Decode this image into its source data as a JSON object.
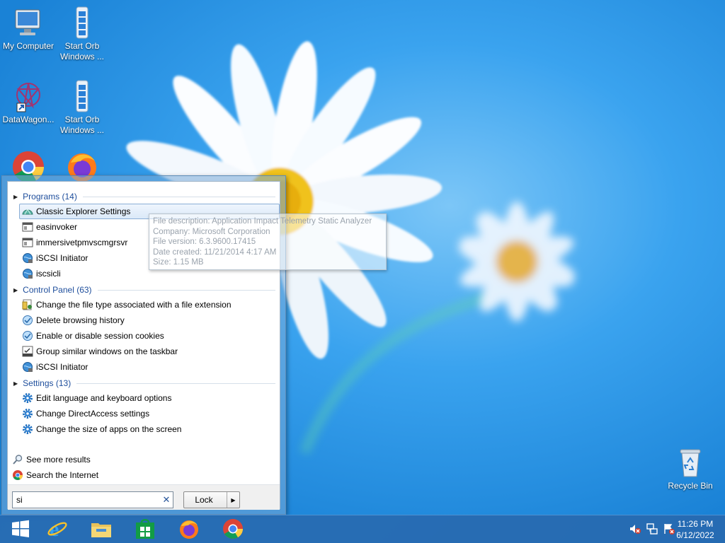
{
  "desktop": {
    "icons": [
      {
        "label": "My Computer"
      },
      {
        "label": "Start Orb Windows ..."
      },
      {
        "label": "DataWagon..."
      },
      {
        "label": "Start Orb Windows ..."
      },
      {
        "label": ""
      },
      {
        "label": ""
      },
      {
        "label": "Recycle Bin"
      }
    ]
  },
  "start_menu": {
    "groups": [
      {
        "header": "Programs (14)",
        "items": [
          {
            "label": "Classic Explorer Settings",
            "icon": "classic-shell-icon",
            "selected": true
          },
          {
            "label": "easinvoker",
            "icon": "app-window-icon"
          },
          {
            "label": "immersivetpmvscmgrsvr",
            "icon": "app-window-icon"
          },
          {
            "label": "iSCSI Initiator",
            "icon": "iscsi-globe-icon"
          },
          {
            "label": "iscsicli",
            "icon": "iscsi-globe-icon"
          }
        ]
      },
      {
        "header": "Control Panel (63)",
        "items": [
          {
            "label": "Change the file type associated with a file extension",
            "icon": "default-programs-icon"
          },
          {
            "label": "Delete browsing history",
            "icon": "internet-options-icon"
          },
          {
            "label": "Enable or disable session cookies",
            "icon": "internet-options-icon"
          },
          {
            "label": "Group similar windows on the taskbar",
            "icon": "taskbar-settings-icon"
          },
          {
            "label": "iSCSI Initiator",
            "icon": "iscsi-globe-icon"
          }
        ]
      },
      {
        "header": "Settings (13)",
        "items": [
          {
            "label": "Edit language and keyboard options",
            "icon": "gear-icon"
          },
          {
            "label": "Change DirectAccess settings",
            "icon": "gear-icon"
          },
          {
            "label": "Change the size of apps on the screen",
            "icon": "gear-icon"
          }
        ]
      }
    ],
    "see_more": "See more results",
    "search_internet": "Search the Internet",
    "search_value": "si",
    "clear_symbol": "✕",
    "lock_label": "Lock"
  },
  "tooltip": {
    "lines": [
      "File description: Application Impact Telemetry Static Analyzer",
      "Company: Microsoft Corporation",
      "File version: 6.3.9600.17415",
      "Date created: 11/21/2014 4:17 AM",
      "Size: 1.15 MB"
    ]
  },
  "taskbar": {
    "time": "11:26 PM",
    "date": "6/12/2022"
  }
}
